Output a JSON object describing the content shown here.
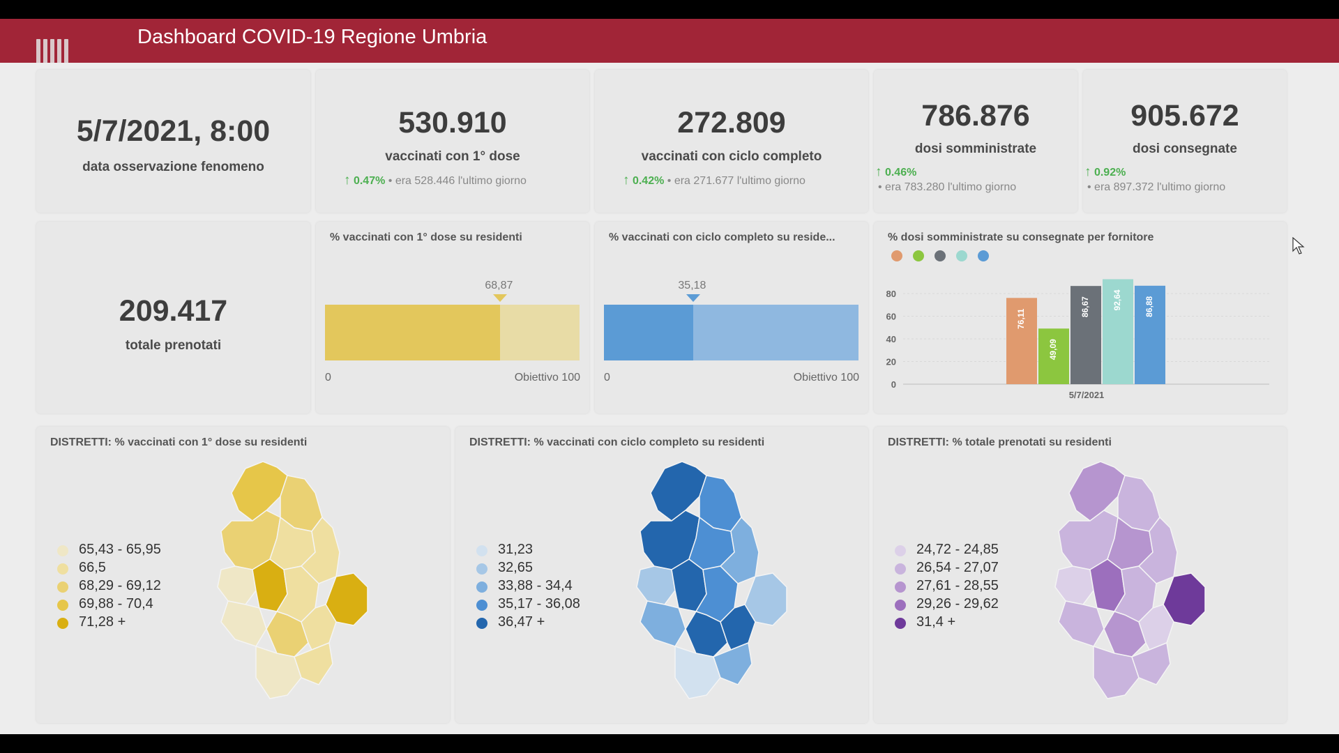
{
  "header": {
    "title": "Dashboard COVID-19 Regione Umbria"
  },
  "kpis": {
    "date": {
      "value": "5/7/2021, 8:00",
      "label": "data osservazione fenomeno"
    },
    "first_dose": {
      "value": "530.910",
      "label": "vaccinati con 1° dose",
      "pct": "0.47%",
      "prev": "era 528.446",
      "suffix": "l'ultimo giorno"
    },
    "full_cycle": {
      "value": "272.809",
      "label": "vaccinati con ciclo completo",
      "pct": "0.42%",
      "prev": "era 271.677",
      "suffix": "l'ultimo giorno"
    },
    "administered": {
      "value": "786.876",
      "label": "dosi somministrate",
      "pct": "0.46%",
      "prev": "era 783.280",
      "suffix": "l'ultimo giorno"
    },
    "delivered": {
      "value": "905.672",
      "label": "dosi consegnate",
      "pct": "0.92%",
      "prev": "era 897.372",
      "suffix": "l'ultimo giorno"
    },
    "booked": {
      "value": "209.417",
      "label": "totale prenotati"
    }
  },
  "gauges": [
    {
      "title": "% vaccinati con 1° dose su residenti",
      "value": 68.87,
      "value_label": "68,87",
      "min_label": "0",
      "max_label": "Obiettivo 100",
      "color": "#e3c75c",
      "rest_color": "#e8dca6"
    },
    {
      "title": "% vaccinati con ciclo completo su reside...",
      "value": 35.18,
      "value_label": "35,18",
      "min_label": "0",
      "max_label": "Obiettivo 100",
      "color": "#5b9bd5",
      "rest_color": "#8fb8e0"
    }
  ],
  "chart_data": {
    "type": "bar",
    "title": "% dosi somministrate su consegnate per fornitore",
    "categories": [
      "5/7/2021"
    ],
    "series": [
      {
        "values": [
          76.11
        ],
        "label": "76,11",
        "color": "#e09a6e"
      },
      {
        "values": [
          49.09
        ],
        "label": "49,09",
        "color": "#8cc63f"
      },
      {
        "values": [
          86.67
        ],
        "label": "86,67",
        "color": "#6b7178"
      },
      {
        "values": [
          92.64
        ],
        "label": "92,64",
        "color": "#9cd8cf"
      },
      {
        "values": [
          86.88
        ],
        "label": "86,88",
        "color": "#5b9bd5"
      }
    ],
    "yticks": [
      "0",
      "20",
      "40",
      "60",
      "80"
    ],
    "ylim": [
      0,
      100
    ],
    "legend": "top-left"
  },
  "maps": [
    {
      "title": "DISTRETTI: % vaccinati con 1° dose su residenti",
      "legend": [
        {
          "label": "65,43 - 65,95",
          "color": "#efe7c6"
        },
        {
          "label": "66,5",
          "color": "#efdfa0"
        },
        {
          "label": "68,29 - 69,12",
          "color": "#ead173"
        },
        {
          "label": "69,88 - 70,4",
          "color": "#e6c649"
        },
        {
          "label": "71,28 +",
          "color": "#d9af12"
        }
      ]
    },
    {
      "title": "DISTRETTI: % vaccinati con ciclo completo su residenti",
      "legend": [
        {
          "label": "31,23",
          "color": "#d2e1ef"
        },
        {
          "label": "32,65",
          "color": "#a6c7e6"
        },
        {
          "label": "33,88 - 34,4",
          "color": "#7eafde"
        },
        {
          "label": "35,17 - 36,08",
          "color": "#4d8fd3"
        },
        {
          "label": "36,47 +",
          "color": "#2366ad"
        }
      ]
    },
    {
      "title": "DISTRETTI: % totale prenotati su residenti",
      "legend": [
        {
          "label": "24,72 - 24,85",
          "color": "#dcd0e8"
        },
        {
          "label": "26,54 - 27,07",
          "color": "#c9b4dd"
        },
        {
          "label": "27,61 - 28,55",
          "color": "#b695cf"
        },
        {
          "label": "29,26 - 29,62",
          "color": "#9c6fbd"
        },
        {
          "label": "31,4 +",
          "color": "#6e3a9a"
        }
      ]
    }
  ],
  "icons": {
    "logo": "region-logo-icon",
    "up": "arrow-up-icon",
    "cursor": "mouse-cursor-icon"
  }
}
